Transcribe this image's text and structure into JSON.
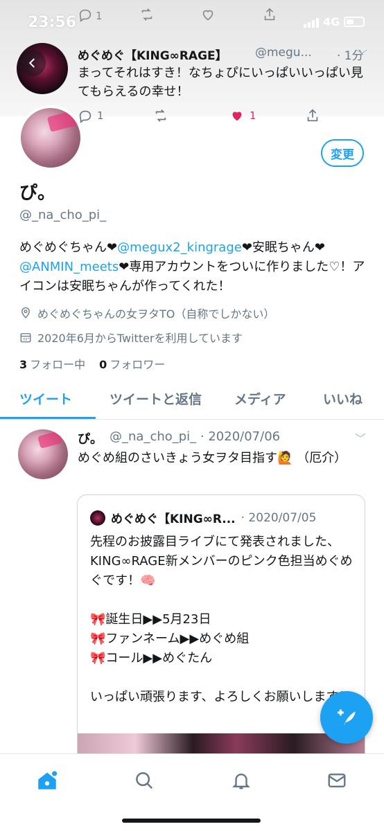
{
  "status_bar": {
    "time": "23:56",
    "network": "4G"
  },
  "overlay_tweet": {
    "author_name": "めぐめぐ【KING∞RAGE】",
    "author_handle": "@megu...",
    "time": "· 1分",
    "text": "まってそれはすき！なちょぴにいっぱいいっぱい見てもらえるの幸せ！",
    "reply_count": "1",
    "like_count": "1",
    "ghost_reply_count": "1"
  },
  "profile": {
    "edit_label": "変更",
    "display_name": "ぴ。",
    "username": "@_na_cho_pi_",
    "bio_part1": "めぐめぐちゃん❤",
    "bio_link1": "@megux2_kingrage",
    "bio_part2": "❤安眠ちゃん❤",
    "bio_link2": "@ANMIN_meets",
    "bio_part3": "❤専用アカウントをついに作りました♡！アイコンは安眠ちゃんが作ってくれた！",
    "location": "めぐめぐちゃんの女ヲタTO（自称でしかない）",
    "joined": "2020年6月からTwitterを利用しています",
    "following_count": "3",
    "following_label": "フォロー中",
    "followers_count": "0",
    "followers_label": "フォロワー"
  },
  "tabs": [
    {
      "label": "ツイート"
    },
    {
      "label": "ツイートと返信"
    },
    {
      "label": "メディア"
    },
    {
      "label": "いいね"
    }
  ],
  "tweet": {
    "author_name": "ぴ。",
    "author_meta": "@_na_cho_pi_ · 2020/07/06",
    "text": "めぐめ組のさいきょう女ヲタ目指す🙋 （厄介）",
    "quote": {
      "author_name": "めぐめぐ【KING∞R...",
      "date": "· 2020/07/05",
      "lines": [
        "先程のお披露目ライブにて発表されました、KING∞RAGE新メンバーのピンク色担当めぐめぐです！🧠",
        "",
        "🎀誕生日▶▶5月23日",
        "🎀ファンネーム▶▶めぐめ組",
        "🎀コール▶▶めぐたん",
        "",
        "いっぱい頑張ります、よろしくお願いします！"
      ]
    }
  },
  "colors": {
    "accent": "#1da1f2",
    "like": "#e0245e",
    "secondary_text": "#657786"
  }
}
